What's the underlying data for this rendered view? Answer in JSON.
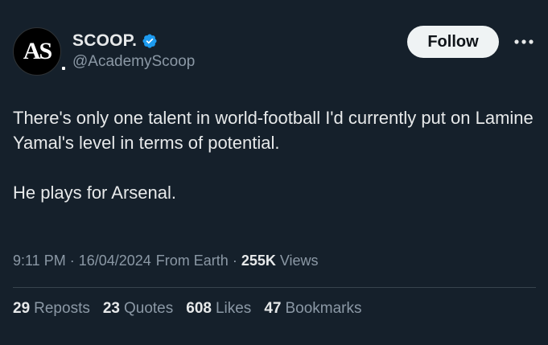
{
  "author": {
    "avatar_text": "AS",
    "display_name": "SCOOP.",
    "handle": "@AcademyScoop",
    "verified_color": "#1d9bf0"
  },
  "actions": {
    "follow_label": "Follow",
    "more_icon": "more-horizontal-icon"
  },
  "tweet": {
    "paragraphs": [
      "There's only one talent in world-football I'd currently put on Lamine Yamal's level in terms of potential.",
      "He plays for Arsenal."
    ]
  },
  "meta": {
    "time": "9:11 PM",
    "date": "16/04/2024",
    "source": "From Earth",
    "views_count": "255K",
    "views_label": "Views",
    "separator": "·"
  },
  "stats": {
    "reposts_count": "29",
    "reposts_label": "Reposts",
    "quotes_count": "23",
    "quotes_label": "Quotes",
    "likes_count": "608",
    "likes_label": "Likes",
    "bookmarks_count": "47",
    "bookmarks_label": "Bookmarks"
  },
  "colors": {
    "background": "#15202b",
    "primary_text": "#e7e9ea",
    "secondary_text": "#8b98a5",
    "follow_bg": "#eff3f4"
  }
}
